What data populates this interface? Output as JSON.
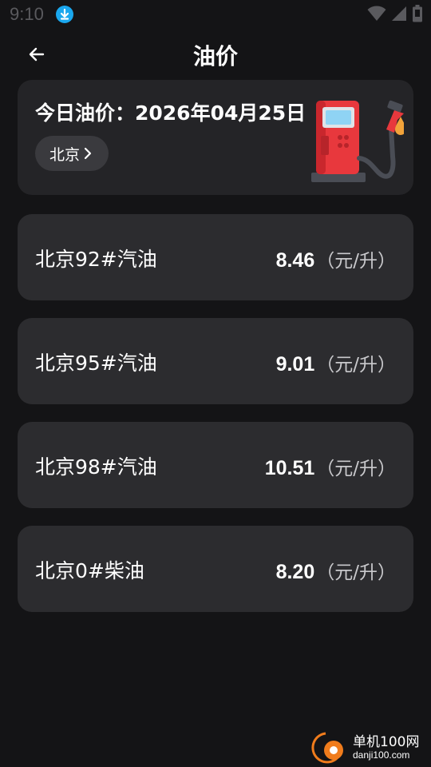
{
  "status_bar": {
    "time": "9:10",
    "icons": [
      "download-icon",
      "wifi-icon",
      "signal-icon",
      "battery-icon"
    ],
    "download_color": "#1aa7ee"
  },
  "header": {
    "title": "油价",
    "back_icon": "arrow-left-icon"
  },
  "date_card": {
    "title": "今日油价：2026年04月25日",
    "city": "北京",
    "city_chevron": "chevron-right-icon",
    "illustration": "fuel-pump-icon"
  },
  "prices": [
    {
      "name": "北京92#汽油",
      "value": "8.46",
      "unit": "（元/升）"
    },
    {
      "name": "北京95#汽油",
      "value": "9.01",
      "unit": "（元/升）"
    },
    {
      "name": "北京98#汽油",
      "value": "10.51",
      "unit": "（元/升）"
    },
    {
      "name": "北京0#柴油",
      "value": "8.20",
      "unit": "（元/升）"
    }
  ],
  "watermark": {
    "line1": "单机100网",
    "line2": "danji100.com"
  },
  "colors": {
    "background": "#141416",
    "card": "#2c2c2f",
    "pump_red": "#e8383d",
    "pump_screen": "#8fd3f4",
    "drop_orange": "#f2a33a"
  }
}
